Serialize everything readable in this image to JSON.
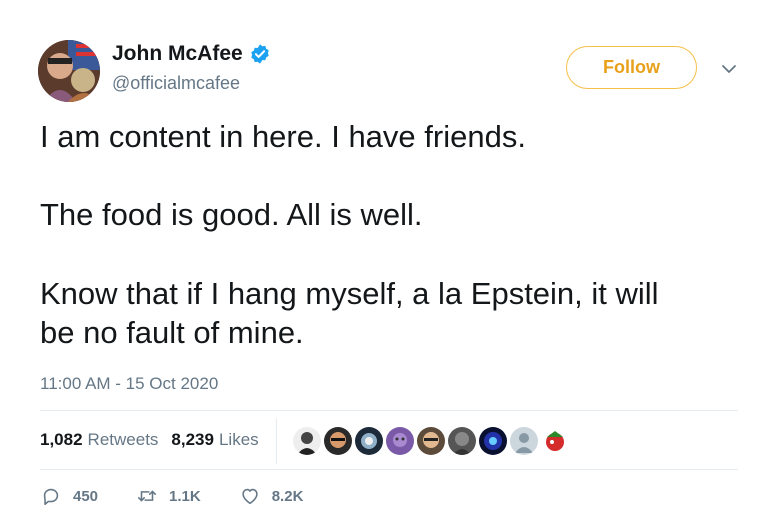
{
  "tweet": {
    "author": {
      "display_name": "John McAfee",
      "handle": "@officialmcafee",
      "verified": true
    },
    "follow_label": "Follow",
    "lines": [
      "I am content in here. I have friends.",
      "The food is good. All is well.",
      "Know that if I hang myself, a la Epstein, it will",
      "be no fault of mine."
    ],
    "timestamp": "11:00 AM - 15 Oct 2020",
    "stats": {
      "retweets_count": "1,082",
      "retweets_label": "Retweets",
      "likes_count": "8,239",
      "likes_label": "Likes"
    },
    "actions": {
      "replies": "450",
      "retweets": "1.1K",
      "likes": "8.2K"
    }
  },
  "colors": {
    "follow_accent": "#e8a11a",
    "follow_border": "#f5c04a",
    "muted": "#657786",
    "verified": "#1da1f2"
  }
}
